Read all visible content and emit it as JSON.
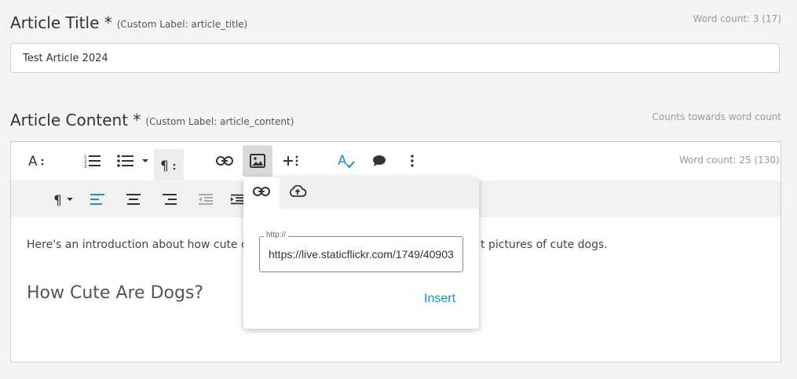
{
  "title_field": {
    "label": "Article Title *",
    "custom_label": "(Custom Label: article_title)",
    "word_count": "Word count: 3 (17)",
    "value": "Test Article 2024"
  },
  "content_field": {
    "label": "Article Content *",
    "custom_label": "(Custom Label: article_content)",
    "note": "Counts towards word count",
    "word_count_prefix": "Word count:",
    "word_count_value": " 25 (130)",
    "intro_text_left": "Here's an introduction about how cute dog",
    "intro_text_right": "t pictures of cute dogs.",
    "heading": "How Cute Are Dogs?"
  },
  "toolbar": {
    "icons": [
      "font-size-icon",
      "ordered-list-icon",
      "unordered-list-icon",
      "list-dropdown-icon",
      "paragraph-format-icon",
      "link-icon",
      "image-icon",
      "more-insert-icon",
      "spellcheck-icon",
      "comment-icon",
      "more-options-icon"
    ],
    "row2_icons": [
      "paragraph-style-icon",
      "align-left-icon",
      "align-center-icon",
      "align-right-icon",
      "outdent-icon",
      "indent-icon"
    ]
  },
  "image_popup": {
    "tabs": [
      "by-url-tab",
      "upload-tab"
    ],
    "url_label": "http://",
    "url_value": "https://live.staticflickr.com/1749/40903",
    "insert_label": "Insert"
  },
  "colors": {
    "accent": "#1a8fd8",
    "background": "#f4f4f4"
  }
}
